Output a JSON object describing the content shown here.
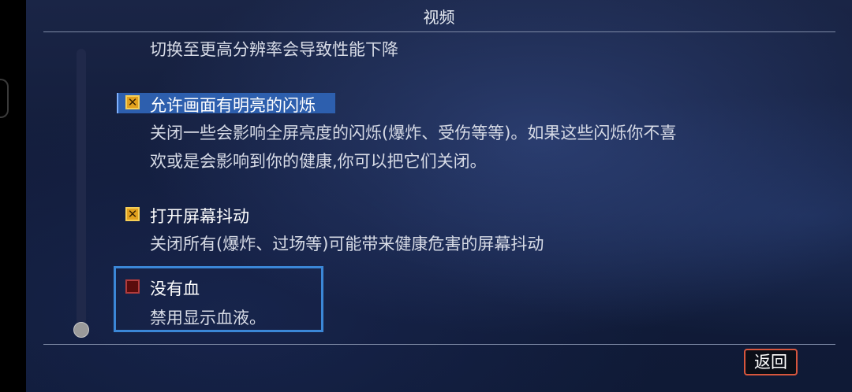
{
  "header": {
    "title": "视频"
  },
  "options": [
    {
      "label": "",
      "description": "切换至更高分辨率会导致性能下降"
    },
    {
      "label": "允许画面有明亮的闪烁",
      "checked": true,
      "description_lines": [
        "关闭一些会影响全屏亮度的闪烁(爆炸、受伤等等)。如果这些闪烁你不喜",
        "欢或是会影响到你的健康,你可以把它们关闭。"
      ]
    },
    {
      "label": "打开屏幕抖动",
      "checked": true,
      "description": "关闭所有(爆炸、过场等)可能带来健康危害的屏幕抖动"
    },
    {
      "label": "没有血",
      "checked": false,
      "description": "禁用显示血液。"
    }
  ],
  "footer": {
    "back_label": "返回"
  },
  "colors": {
    "accent_checked": "#e2a11e",
    "focus": "#3b87d7",
    "back_border": "#d7563d"
  }
}
